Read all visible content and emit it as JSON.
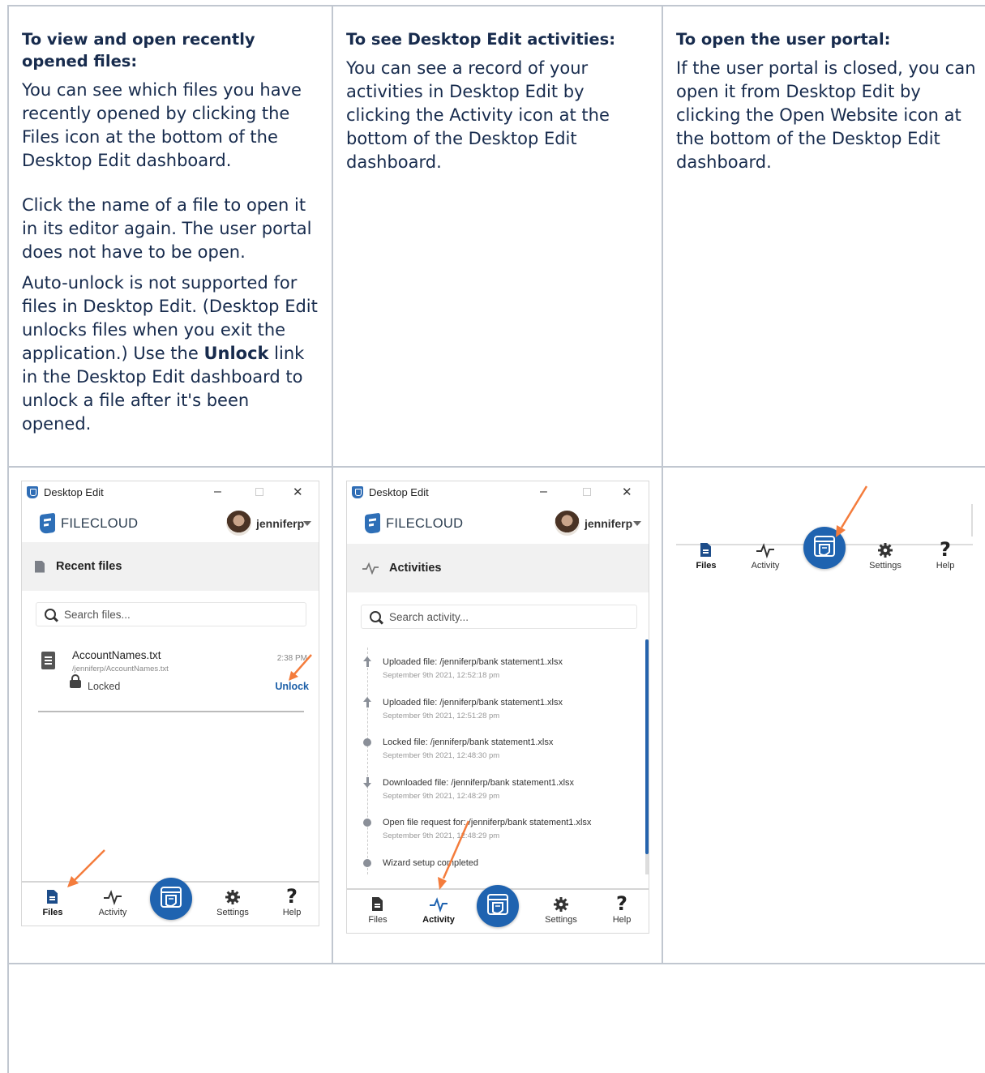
{
  "columns": [
    {
      "heading": "To view and open recently opened files:",
      "paragraphs": [
        "You can see which files you have recently opened by clicking the Files icon at the bottom of the Desktop Edit dashboard.",
        "Click the name of a file to open it in its editor again. The user portal does not have to be open."
      ],
      "note_before": "Auto-unlock is not supported for files in Desktop Edit. (Desktop Edit unlocks files when you exit the application.) Use the ",
      "note_bold": "Unlock",
      "note_after": " link in the Desktop Edit dashboard to unlock a file after it's been opened."
    },
    {
      "heading": "To see Desktop Edit activities:",
      "paragraphs": [
        "You can see a record of your activities in Desktop Edit by clicking the Activity icon at the bottom of the Desktop Edit dashboard."
      ]
    },
    {
      "heading": "To open the user portal:",
      "paragraphs": [
        "If the user portal is closed, you can open it from  Desktop Edit by clicking the Open Website icon at the bottom of the Desktop Edit dashboard."
      ]
    }
  ],
  "app": {
    "window_title": "Desktop Edit",
    "brand": "FILECLOUD",
    "username": "jenniferp",
    "minimize": "–",
    "close": "✕",
    "accent_color": "#1f63b0",
    "arrow_color": "#f47c3c"
  },
  "recent": {
    "section_title": "Recent files",
    "search_placeholder": "Search files...",
    "file": {
      "name": "AccountNames.txt",
      "path": "/jenniferp/AccountNames.txt",
      "time": "2:38 PM",
      "status": "Locked",
      "action": "Unlock"
    }
  },
  "activities": {
    "section_title": "Activities",
    "search_placeholder": "Search activity...",
    "items": [
      {
        "icon": "upload-icon",
        "text": "Uploaded file: /jenniferp/bank statement1.xlsx",
        "date": "September 9th 2021, 12:52:18 pm"
      },
      {
        "icon": "upload-icon",
        "text": "Uploaded file: /jenniferp/bank statement1.xlsx",
        "date": "September 9th 2021, 12:51:28 pm"
      },
      {
        "icon": "dot-icon",
        "text": "Locked file: /jenniferp/bank statement1.xlsx",
        "date": "September 9th 2021, 12:48:30 pm"
      },
      {
        "icon": "download-icon",
        "text": "Downloaded file: /jenniferp/bank statement1.xlsx",
        "date": "September 9th 2021, 12:48:29 pm"
      },
      {
        "icon": "dot-icon",
        "text": "Open file request for: /jenniferp/bank statement1.xlsx",
        "date": "September 9th 2021, 12:48:29 pm"
      },
      {
        "icon": "dot-icon",
        "text": "Wizard setup completed",
        "date": ""
      }
    ]
  },
  "nav": {
    "files": "Files",
    "activity": "Activity",
    "settings": "Settings",
    "help": "Help",
    "help_glyph": "?"
  }
}
